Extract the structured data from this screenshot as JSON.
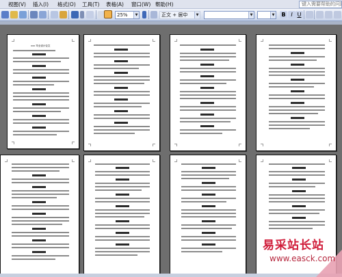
{
  "menubar": {
    "items": [
      {
        "label": "视图(V)",
        "name": "menu-view"
      },
      {
        "label": "插入(I)",
        "name": "menu-insert"
      },
      {
        "label": "格式(O)",
        "name": "menu-format"
      },
      {
        "label": "工具(T)",
        "name": "menu-tools"
      },
      {
        "label": "表格(A)",
        "name": "menu-table"
      },
      {
        "label": "窗口(W)",
        "name": "menu-window"
      },
      {
        "label": "帮助(H)",
        "name": "menu-help"
      }
    ],
    "help_search_placeholder": "键入需要帮助的问题"
  },
  "toolbar": {
    "zoom_value": "25%",
    "style_value": "正文 + 居中",
    "buttons": [
      "print-preview-icon",
      "spelling-icon",
      "research-icon",
      "cut-icon",
      "copy-icon",
      "paste-icon",
      "format-painter-icon",
      "undo-icon",
      "redo-icon",
      "hyperlink-icon",
      "drawing-icon",
      "help-icon"
    ],
    "format_buttons": [
      "bold-icon",
      "italic-icon",
      "underline-icon",
      "align-justify-icon",
      "numbering-icon",
      "bullets-icon",
      "indent-icon"
    ]
  },
  "document": {
    "first_page_title": "xxx 毕业设计论文",
    "page_count_visible": 8
  },
  "watermark": {
    "title": "易采站长站",
    "url": "www.easck.com",
    "color": "#d01d3a"
  },
  "colors": {
    "menubar_bg": "#dfe3ee",
    "canvas_bg": "#6e6e6e",
    "text_line": "#8a8a8a",
    "heading_bar": "#2a2a2a"
  }
}
